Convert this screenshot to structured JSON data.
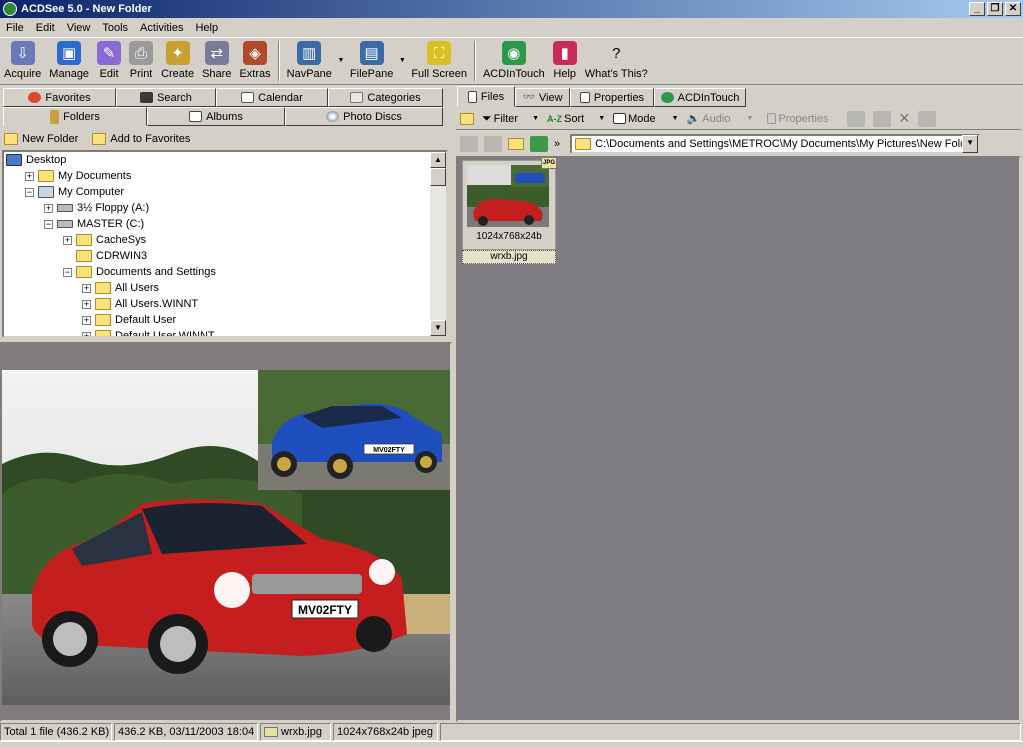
{
  "window": {
    "title": "ACDSee 5.0 - New Folder",
    "buttons": [
      "_",
      "❐",
      "✕"
    ]
  },
  "menu": [
    "File",
    "Edit",
    "View",
    "Tools",
    "Activities",
    "Help"
  ],
  "toolbar": [
    {
      "label": "Acquire",
      "icon": "acquire-icon",
      "color": "#6a7ab8"
    },
    {
      "label": "Manage",
      "icon": "manage-icon",
      "color": "#2c6ad0"
    },
    {
      "label": "Edit",
      "icon": "edit-icon",
      "color": "#8a6ad8"
    },
    {
      "label": "Print",
      "icon": "print-icon",
      "color": "#9a9a9a"
    },
    {
      "label": "Create",
      "icon": "create-icon",
      "color": "#c8a030"
    },
    {
      "label": "Share",
      "icon": "share-icon",
      "color": "#7a7a9a"
    },
    {
      "label": "Extras",
      "icon": "extras-icon",
      "color": "#b04a2a"
    },
    {
      "label": "NavPane",
      "icon": "navpane-icon",
      "color": "#3a6aa8"
    },
    {
      "label": "FilePane",
      "icon": "filepane-icon",
      "color": "#3a6aa8"
    },
    {
      "label": "Full Screen",
      "icon": "fullscreen-icon",
      "color": "#d8c020"
    },
    {
      "label": "ACDInTouch",
      "icon": "acdintouch-icon",
      "color": "#2a9a4a"
    },
    {
      "label": "Help",
      "icon": "help-book-icon",
      "color": "#c82a5a"
    },
    {
      "label": "What's This?",
      "icon": "whats-this-icon",
      "color": "#d4d0c8"
    }
  ],
  "left_tabs": {
    "row1": [
      "Favorites",
      "Search",
      "Calendar",
      "Categories"
    ],
    "row2": [
      "Folders",
      "Albums",
      "Photo Discs"
    ]
  },
  "folder_actions": {
    "new_folder": "New Folder",
    "add_favorites": "Add to Favorites"
  },
  "tree": [
    {
      "label": "Desktop",
      "indent": 0,
      "expander": ""
    },
    {
      "label": "My Documents",
      "indent": 1,
      "expander": "+"
    },
    {
      "label": "My Computer",
      "indent": 1,
      "expander": "−"
    },
    {
      "label": "3½ Floppy (A:)",
      "indent": 2,
      "expander": "+"
    },
    {
      "label": "MASTER (C:)",
      "indent": 2,
      "expander": "−"
    },
    {
      "label": "CacheSys",
      "indent": 3,
      "expander": "+"
    },
    {
      "label": "CDRWIN3",
      "indent": 3,
      "expander": ""
    },
    {
      "label": "Documents and Settings",
      "indent": 3,
      "expander": "−"
    },
    {
      "label": "All Users",
      "indent": 4,
      "expander": "+"
    },
    {
      "label": "All Users.WINNT",
      "indent": 4,
      "expander": "+"
    },
    {
      "label": "Default User",
      "indent": 4,
      "expander": "+"
    },
    {
      "label": "Default User.WINNT",
      "indent": 4,
      "expander": "+"
    }
  ],
  "right_tabs": [
    "Files",
    "View",
    "Properties",
    "ACDInTouch"
  ],
  "file_toolbar": {
    "filter": "Filter",
    "sort": "Sort",
    "mode": "Mode",
    "audio": "Audio",
    "properties": "Properties"
  },
  "address": "C:\\Documents and Settings\\METROC\\My Documents\\My Pictures\\New Folder",
  "thumbnail": {
    "dims": "1024x768x24b",
    "name": "wrxb.jpg",
    "badge": "JPG"
  },
  "preview": {
    "plate_red": "MV02FTY",
    "plate_blue": "MV02FTY"
  },
  "status": [
    "Total 1 file (436.2 KB)",
    "436.2 KB, 03/11/2003 18:04",
    "wrxb.jpg",
    "1024x768x24b jpeg"
  ]
}
